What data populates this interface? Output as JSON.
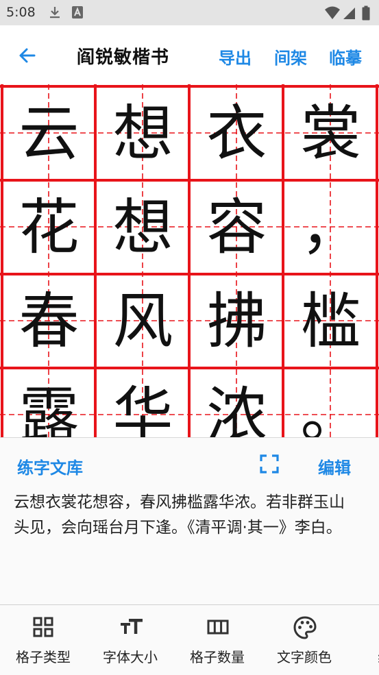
{
  "status_bar": {
    "time": "5:08"
  },
  "app_bar": {
    "title": "阎锐敏楷书",
    "actions": [
      "导出",
      "间架",
      "临摹"
    ]
  },
  "grid": {
    "line_color": "#e8141a",
    "rows": [
      [
        "云",
        "想",
        "衣",
        "裳"
      ],
      [
        "花",
        "想",
        "容",
        "，"
      ],
      [
        "春",
        "风",
        "拂",
        "槛"
      ],
      [
        "露",
        "华",
        "浓",
        "。"
      ]
    ]
  },
  "panel": {
    "library_label": "练字文库",
    "edit_label": "编辑",
    "text": "云想衣裳花想容，春风拂槛露华浓。若非群玉山头见，会向瑶台月下逢。《清平调·其一》李白。"
  },
  "bottom_nav": {
    "items": [
      {
        "label": "格子类型",
        "icon": "grid-type-icon"
      },
      {
        "label": "字体大小",
        "icon": "font-size-icon"
      },
      {
        "label": "格子数量",
        "icon": "grid-count-icon"
      },
      {
        "label": "文字颜色",
        "icon": "palette-icon"
      },
      {
        "label": "线条",
        "icon": "line-icon"
      }
    ]
  },
  "colors": {
    "accent": "#1e88e5",
    "grid_red": "#e8141a"
  }
}
